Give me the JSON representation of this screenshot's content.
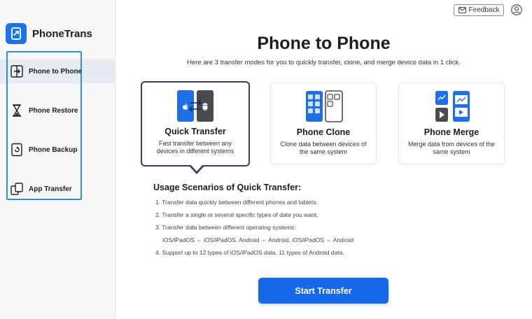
{
  "app": {
    "name": "PhoneTrans"
  },
  "sidebar": {
    "items": [
      {
        "label": "Phone to Phone",
        "icon": "phone-transfer-icon",
        "active": true
      },
      {
        "label": "Phone Restore",
        "icon": "hourglass-icon",
        "active": false
      },
      {
        "label": "Phone Backup",
        "icon": "backup-icon",
        "active": false
      },
      {
        "label": "App Transfer",
        "icon": "app-transfer-icon",
        "active": false
      }
    ]
  },
  "header": {
    "feedback_label": "Feedback"
  },
  "main": {
    "title": "Phone to Phone",
    "subtitle": "Here are 3 transfer modes for you to quickly transfer, clone, and merge device data in 1 click.",
    "cards": [
      {
        "title": "Quick Transfer",
        "desc": "Fast transfer between any devices in different systems",
        "selected": true
      },
      {
        "title": "Phone Clone",
        "desc": "Clone data between devices of the same system",
        "selected": false
      },
      {
        "title": "Phone Merge",
        "desc": "Merge data from devices of the same system",
        "selected": false
      }
    ],
    "usage": {
      "title": "Usage Scenarios of Quick Transfer:",
      "items": [
        "1. Transfer data quickly between different phones and tablets.",
        "2. Transfer a single or several specific types of data you want.",
        "3. Transfer data between different operating systems:",
        "iOS/iPadOS ⇔ iOS/iPadOS, Android ⇔ Android, iOS/iPadOS ⇔ Android",
        "4. Support up to 12 types of iOS/iPadOS data, 11 types of Android data."
      ]
    },
    "start_label": "Start Transfer"
  },
  "colors": {
    "accent": "#1768e8",
    "selected_border": "#33406b",
    "nav_highlight": "#2f8fde"
  }
}
